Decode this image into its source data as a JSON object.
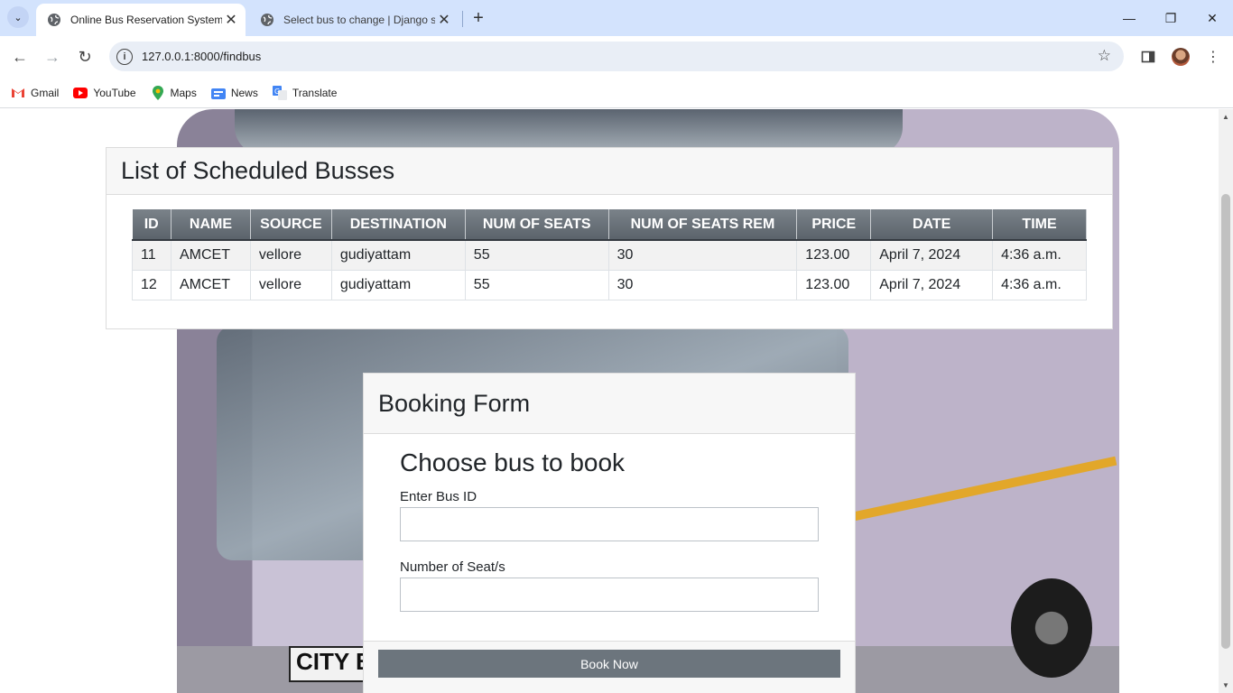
{
  "browser": {
    "tabs": [
      {
        "title": "Online Bus Reservation System",
        "active": true
      },
      {
        "title": "Select bus to change | Django site admin",
        "active": false
      }
    ],
    "url": "127.0.0.1:8000/findbus",
    "bookmarks": [
      "Gmail",
      "YouTube",
      "Maps",
      "News",
      "Translate"
    ]
  },
  "schedule": {
    "title": "List of Scheduled Busses",
    "columns": [
      "ID",
      "NAME",
      "SOURCE",
      "DESTINATION",
      "NUM OF SEATS",
      "NUM OF SEATS REM",
      "PRICE",
      "DATE",
      "TIME"
    ],
    "rows": [
      [
        "11",
        "AMCET",
        "vellore",
        "gudiyattam",
        "55",
        "30",
        "123.00",
        "April 7, 2024",
        "4:36 a.m."
      ],
      [
        "12",
        "AMCET",
        "vellore",
        "gudiyattam",
        "55",
        "30",
        "123.00",
        "April 7, 2024",
        "4:36 a.m."
      ]
    ]
  },
  "booking": {
    "title": "Booking Form",
    "heading": "Choose bus to book",
    "bus_id_label": "Enter Bus ID",
    "bus_id_value": "",
    "seats_label": "Number of Seat/s",
    "seats_value": "",
    "submit_label": "Book Now"
  },
  "background_image": "bus-image"
}
